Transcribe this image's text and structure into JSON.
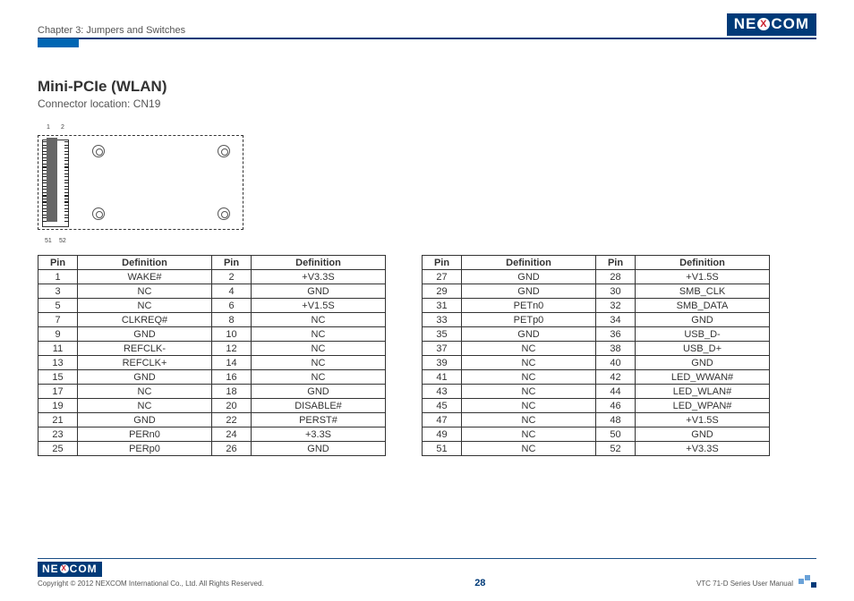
{
  "header": {
    "chapter_label": "Chapter 3: Jumpers and Switches",
    "logo_left": "NE",
    "logo_x": "X",
    "logo_right": "COM"
  },
  "section": {
    "title": "Mini-PCIe (WLAN)",
    "subtext": "Connector location: CN19"
  },
  "diagram": {
    "pin_labels": {
      "tl": "1",
      "tr": "2",
      "bl": "51",
      "br": "52"
    }
  },
  "table_headers": {
    "pin": "Pin",
    "def": "Definition"
  },
  "table_left": [
    {
      "p1": "1",
      "d1": "WAKE#",
      "p2": "2",
      "d2": "+V3.3S"
    },
    {
      "p1": "3",
      "d1": "NC",
      "p2": "4",
      "d2": "GND"
    },
    {
      "p1": "5",
      "d1": "NC",
      "p2": "6",
      "d2": "+V1.5S"
    },
    {
      "p1": "7",
      "d1": "CLKREQ#",
      "p2": "8",
      "d2": "NC"
    },
    {
      "p1": "9",
      "d1": "GND",
      "p2": "10",
      "d2": "NC"
    },
    {
      "p1": "11",
      "d1": "REFCLK-",
      "p2": "12",
      "d2": "NC"
    },
    {
      "p1": "13",
      "d1": "REFCLK+",
      "p2": "14",
      "d2": "NC"
    },
    {
      "p1": "15",
      "d1": "GND",
      "p2": "16",
      "d2": "NC"
    },
    {
      "p1": "17",
      "d1": "NC",
      "p2": "18",
      "d2": "GND"
    },
    {
      "p1": "19",
      "d1": "NC",
      "p2": "20",
      "d2": "DISABLE#"
    },
    {
      "p1": "21",
      "d1": "GND",
      "p2": "22",
      "d2": "PERST#"
    },
    {
      "p1": "23",
      "d1": "PERn0",
      "p2": "24",
      "d2": "+3.3S"
    },
    {
      "p1": "25",
      "d1": "PERp0",
      "p2": "26",
      "d2": "GND"
    }
  ],
  "table_right": [
    {
      "p1": "27",
      "d1": "GND",
      "p2": "28",
      "d2": "+V1.5S"
    },
    {
      "p1": "29",
      "d1": "GND",
      "p2": "30",
      "d2": "SMB_CLK"
    },
    {
      "p1": "31",
      "d1": "PETn0",
      "p2": "32",
      "d2": "SMB_DATA"
    },
    {
      "p1": "33",
      "d1": "PETp0",
      "p2": "34",
      "d2": "GND"
    },
    {
      "p1": "35",
      "d1": "GND",
      "p2": "36",
      "d2": "USB_D-"
    },
    {
      "p1": "37",
      "d1": "NC",
      "p2": "38",
      "d2": "USB_D+"
    },
    {
      "p1": "39",
      "d1": "NC",
      "p2": "40",
      "d2": "GND"
    },
    {
      "p1": "41",
      "d1": "NC",
      "p2": "42",
      "d2": "LED_WWAN#"
    },
    {
      "p1": "43",
      "d1": "NC",
      "p2": "44",
      "d2": "LED_WLAN#"
    },
    {
      "p1": "45",
      "d1": "NC",
      "p2": "46",
      "d2": "LED_WPAN#"
    },
    {
      "p1": "47",
      "d1": "NC",
      "p2": "48",
      "d2": "+V1.5S"
    },
    {
      "p1": "49",
      "d1": "NC",
      "p2": "50",
      "d2": "GND"
    },
    {
      "p1": "51",
      "d1": "NC",
      "p2": "52",
      "d2": "+V3.3S"
    }
  ],
  "footer": {
    "copyright": "Copyright © 2012 NEXCOM International Co., Ltd. All Rights Reserved.",
    "page": "28",
    "manual": "VTC 71-D Series User Manual"
  }
}
